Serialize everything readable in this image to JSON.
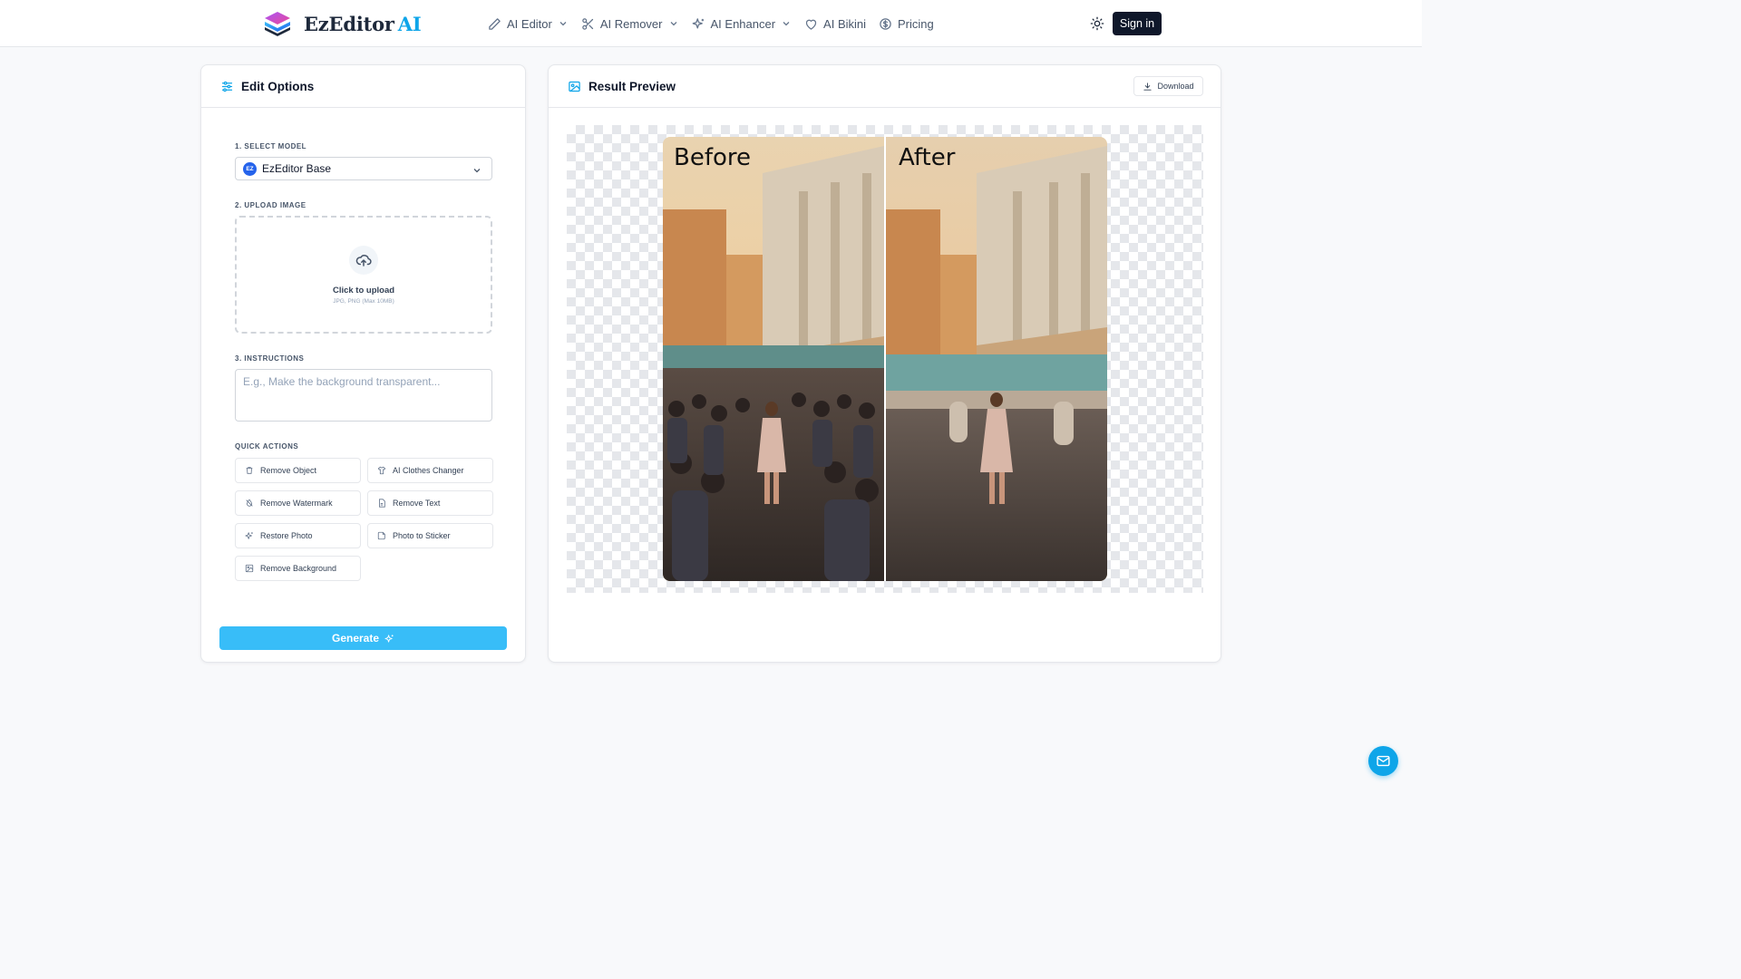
{
  "header": {
    "logo_name": "EzEditor",
    "logo_suffix": "AI",
    "nav": [
      {
        "label": "AI Editor",
        "icon": "pen-icon",
        "dropdown": true
      },
      {
        "label": "AI Remover",
        "icon": "scissors-icon",
        "dropdown": true
      },
      {
        "label": "AI Enhancer",
        "icon": "sparkles-icon",
        "dropdown": true
      },
      {
        "label": "AI Bikini",
        "icon": "heart-icon",
        "dropdown": false
      },
      {
        "label": "Pricing",
        "icon": "dollar-circle-icon",
        "dropdown": false
      }
    ],
    "theme_icon": "sun-icon",
    "signin_label": "Sign in"
  },
  "edit_options": {
    "title": "Edit Options",
    "icon": "sliders-icon",
    "model_label": "1. SELECT MODEL",
    "model_badge": "EZ",
    "model_value": "EzEditor Base",
    "upload_label": "2. UPLOAD IMAGE",
    "upload_title": "Click to upload",
    "upload_sub": "JPG, PNG (Max 10MB)",
    "instructions_label": "3. INSTRUCTIONS",
    "instructions_placeholder": "E.g., Make the background transparent...",
    "instructions_value": "",
    "quick_actions_label": "QUICK ACTIONS",
    "quick_actions": [
      {
        "label": "Remove Object",
        "icon": "trash-icon"
      },
      {
        "label": "AI Clothes Changer",
        "icon": "shirt-icon"
      },
      {
        "label": "Remove Watermark",
        "icon": "droplet-off-icon"
      },
      {
        "label": "Remove Text",
        "icon": "file-text-icon"
      },
      {
        "label": "Restore Photo",
        "icon": "sparkle-icon"
      },
      {
        "label": "Photo to Sticker",
        "icon": "sticker-icon"
      },
      {
        "label": "Remove Background",
        "icon": "image-icon"
      }
    ],
    "generate_label": "Generate"
  },
  "result_preview": {
    "title": "Result Preview",
    "icon": "image-icon",
    "download_label": "Download",
    "before_label": "Before",
    "after_label": "After"
  },
  "colors": {
    "accent": "#0ea5e9",
    "generate": "#38bdf8",
    "signin_bg": "#0f172a"
  }
}
